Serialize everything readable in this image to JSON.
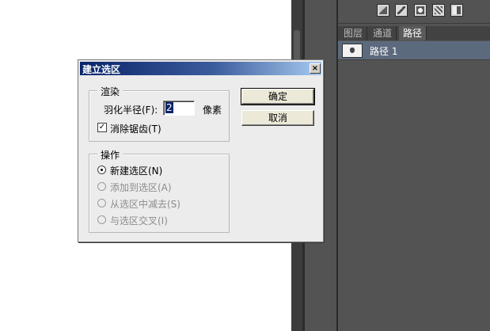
{
  "dialog": {
    "title": "建立选区",
    "close_label": "×",
    "render_group": {
      "legend": "渲染",
      "feather_label": "羽化半径(F):",
      "feather_value": "2",
      "feather_unit": "像素",
      "antialias_label": "消除锯齿(T)",
      "antialias_checked": true,
      "check_mark": "✓"
    },
    "operation_group": {
      "legend": "操作",
      "options": [
        {
          "label": "新建选区(N)",
          "selected": true,
          "enabled": true
        },
        {
          "label": "添加到选区(A)",
          "selected": false,
          "enabled": false
        },
        {
          "label": "从选区中减去(S)",
          "selected": false,
          "enabled": false
        },
        {
          "label": "与选区交叉(I)",
          "selected": false,
          "enabled": false
        }
      ]
    },
    "buttons": {
      "ok": "确定",
      "cancel": "取消"
    }
  },
  "panel": {
    "tabs": [
      "图层",
      "通道",
      "路径"
    ],
    "active_tab": "路径",
    "paths": [
      {
        "name": "路径 1"
      }
    ],
    "tool_icons": [
      "fill-path-icon",
      "stroke-path-icon",
      "load-selection-icon",
      "make-work-path-icon",
      "add-mask-icon"
    ]
  },
  "colors": {
    "panel_bg": "#535353",
    "selected_row": "#5c6a7d",
    "titlebar_start": "#0a246a",
    "titlebar_end": "#a6caf0",
    "dialog_bg": "#ececec"
  }
}
